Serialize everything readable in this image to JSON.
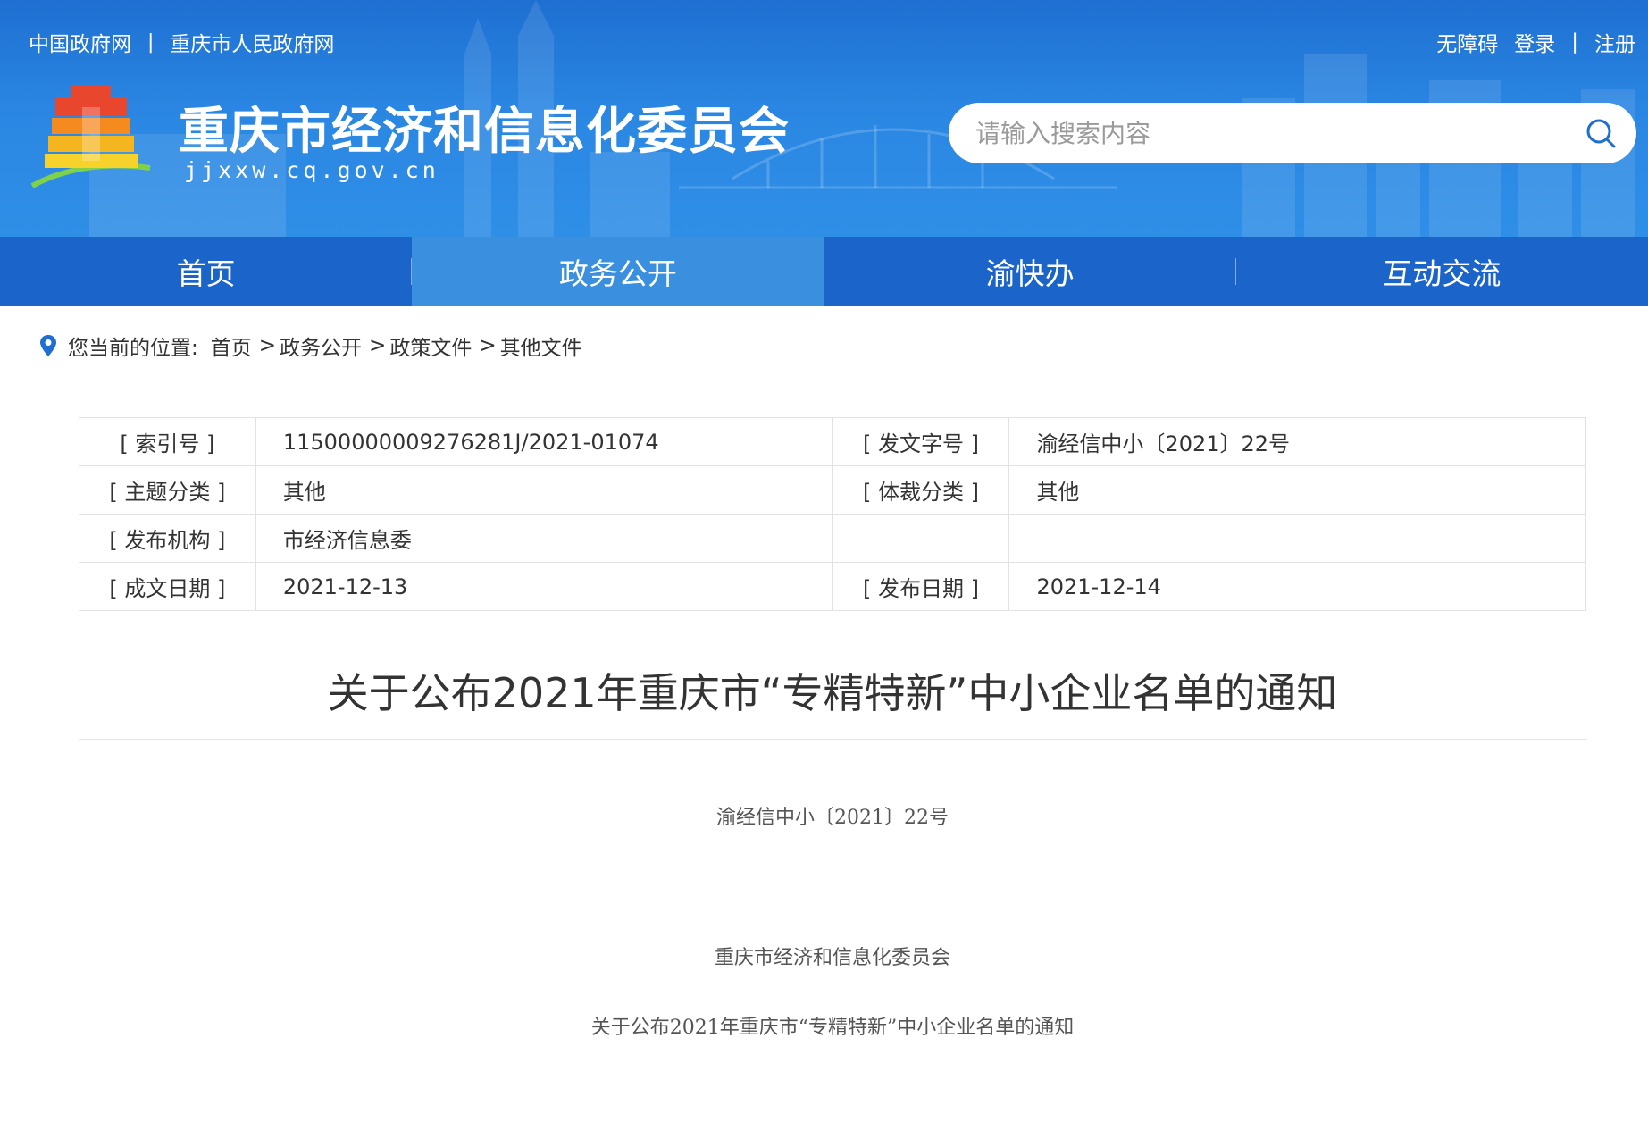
{
  "header": {
    "top_links": [
      "中国政府网",
      "重庆市人民政府网"
    ],
    "top_right": {
      "accessibility": "无障碍",
      "login": "登录",
      "register": "注册",
      "separator": "|"
    },
    "site_title": "重庆市经济和信息化委员会",
    "site_domain": "jjxxw.cq.gov.cn",
    "search": {
      "placeholder": "请输入搜索内容"
    }
  },
  "nav": {
    "items": [
      {
        "label": "首页",
        "active": false
      },
      {
        "label": "政务公开",
        "active": true
      },
      {
        "label": "渝快办",
        "active": false
      },
      {
        "label": "互动交流",
        "active": false
      }
    ]
  },
  "breadcrumb": {
    "prefix": "您当前的位置:",
    "items": [
      "首页",
      "政务公开",
      "政策文件",
      "其他文件"
    ],
    "separator": ">"
  },
  "meta": {
    "rows": [
      [
        "[ 索引号 ]",
        "11500000009276281J/2021-01074",
        "[ 发文字号 ]",
        "渝经信中小〔2021〕22号"
      ],
      [
        "[ 主题分类 ]",
        "其他",
        "[ 体裁分类 ]",
        "其他"
      ],
      [
        "[ 发布机构 ]",
        "市经济信息委",
        "",
        ""
      ],
      [
        "[ 成文日期 ]",
        "2021-12-13",
        "[ 发布日期 ]",
        "2021-12-14"
      ]
    ]
  },
  "article": {
    "title": "关于公布2021年重庆市“专精特新”中小企业名单的通知",
    "doc_number": "渝经信中小〔2021〕22号",
    "issuer": "重庆市经济和信息化委员会",
    "notice_line": "关于公布2021年重庆市“专精特新”中小企业名单的通知"
  },
  "colors": {
    "header_blue": "#2a86e2",
    "nav_blue": "#1b64c9",
    "nav_active": "#3a8fde"
  },
  "icons": {
    "search": "search-icon",
    "location": "location-pin-icon",
    "emblem": "building-emblem-icon"
  }
}
